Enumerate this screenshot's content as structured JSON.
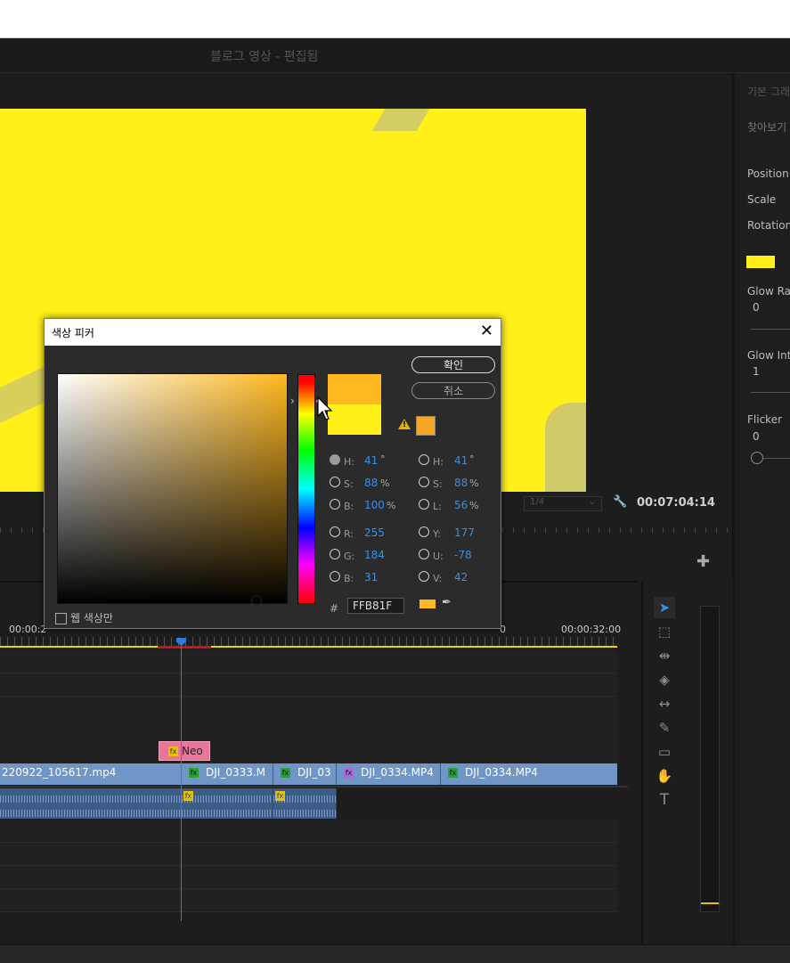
{
  "window": {
    "title": "블로그 영상 - 편집됨"
  },
  "program_monitor": {
    "timecode": "00:07:04:14",
    "zoom": "1/4",
    "preview_color": "#fff01a"
  },
  "effect_controls": {
    "header": "기본 그래",
    "browse": "찾아보기",
    "position_label": "Position",
    "scale_label": "Scale",
    "rotation_label": "Rotation",
    "color_swatch": "#fff01a",
    "glow_radius_label": "Glow Rad",
    "glow_radius_value": "0",
    "glow_intensity_label": "Glow Inte",
    "glow_intensity_value": "1",
    "flicker_label": "Flicker",
    "flicker_value": "0"
  },
  "timeline": {
    "time_start": "00:00:2",
    "time_mid": "0",
    "time_end": "00:00:32:00",
    "graphic_clip": "Neo",
    "video_clips": [
      {
        "name": "220922_105617.mp4"
      },
      {
        "name": "DJI_0333.M"
      },
      {
        "name": "DJI_03"
      },
      {
        "name": "DJI_0334.MP4"
      },
      {
        "name": "DJI_0334.MP4"
      }
    ]
  },
  "color_picker": {
    "title": "색상 피커",
    "ok_label": "확인",
    "cancel_label": "취소",
    "web_colors_label": "웹 색상만",
    "hex": "FFB81F",
    "new_color": "#ffb81f",
    "old_color": "#fff01a",
    "hsb": {
      "h_label": "H:",
      "h_value": "41",
      "h_unit": "°",
      "s_label": "S:",
      "s_value": "88",
      "s_unit": "%",
      "b_label": "B:",
      "b_value": "100",
      "b_unit": "%"
    },
    "hsl": {
      "h_label": "H:",
      "h_value": "41",
      "h_unit": "°",
      "s_label": "S:",
      "s_value": "88",
      "s_unit": "%",
      "l_label": "L:",
      "l_value": "56",
      "l_unit": "%"
    },
    "rgb": {
      "r_label": "R:",
      "r_value": "255",
      "g_label": "G:",
      "g_value": "184",
      "b_label": "B:",
      "b_value": "31"
    },
    "yuv": {
      "y_label": "Y:",
      "y_value": "177",
      "u_label": "U:",
      "u_value": "-78",
      "v_label": "V:",
      "v_value": "42"
    },
    "hash_label": "#"
  }
}
